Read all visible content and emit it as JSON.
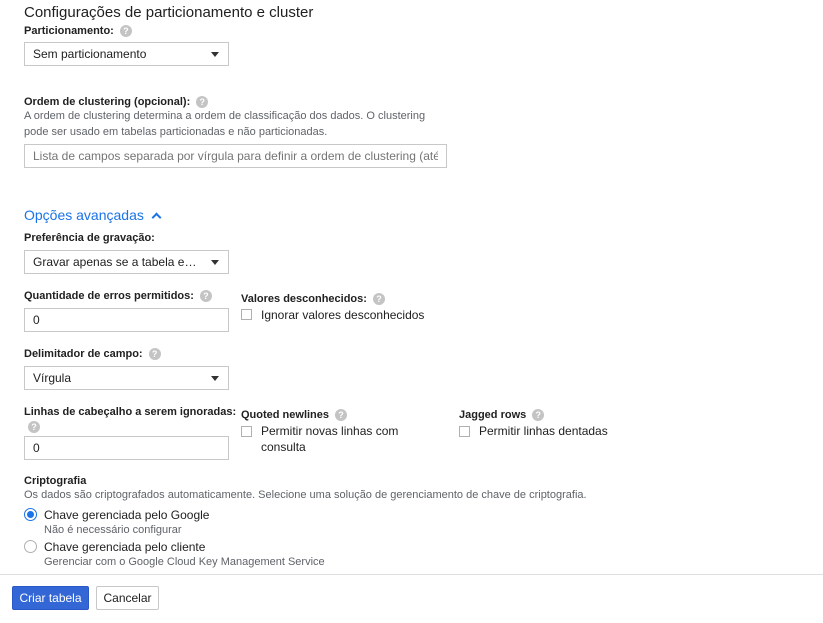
{
  "section_title": "Configurações de particionamento e cluster",
  "partitioning": {
    "label": "Particionamento:",
    "value": "Sem particionamento"
  },
  "clustering": {
    "label": "Ordem de clustering (opcional):",
    "description": "A ordem de clustering determina a ordem de classificação dos dados. O clustering pode ser usado em tabelas particionadas e não particionadas.",
    "placeholder": "Lista de campos separada por vírgula para definir a ordem de clustering (até"
  },
  "advanced": {
    "toggle_label": "Opções avançadas"
  },
  "write_preference": {
    "label": "Preferência de gravação:",
    "value": "Gravar apenas se a tabela esti..."
  },
  "errors_allowed": {
    "label": "Quantidade de erros permitidos:",
    "value": "0"
  },
  "unknown_values": {
    "label": "Valores desconhecidos:",
    "checkbox_label": "Ignorar valores desconhecidos"
  },
  "field_delimiter": {
    "label": "Delimitador de campo:",
    "value": "Vírgula"
  },
  "header_rows": {
    "label": "Linhas de cabeçalho a serem ignoradas:",
    "value": "0"
  },
  "quoted_newlines": {
    "label": "Quoted newlines",
    "checkbox_label_line1": "Permitir novas linhas com",
    "checkbox_label_line2": "consulta"
  },
  "jagged_rows": {
    "label": "Jagged rows",
    "checkbox_label": "Permitir linhas dentadas"
  },
  "encryption": {
    "title": "Criptografia",
    "description": "Os dados são criptografados automaticamente. Selecione uma solução de gerenciamento de chave de criptografia.",
    "options": [
      {
        "label": "Chave gerenciada pelo Google",
        "sub": "Não é necessário configurar",
        "selected": true
      },
      {
        "label": "Chave gerenciada pelo cliente",
        "sub": "Gerenciar com o Google Cloud Key Management Service",
        "selected": false
      }
    ]
  },
  "footer": {
    "create_label": "Criar tabela",
    "cancel_label": "Cancelar"
  },
  "help_icon_glyph": "?",
  "colors": {
    "accent": "#1a73e8",
    "primary_button": "#3367d6"
  }
}
